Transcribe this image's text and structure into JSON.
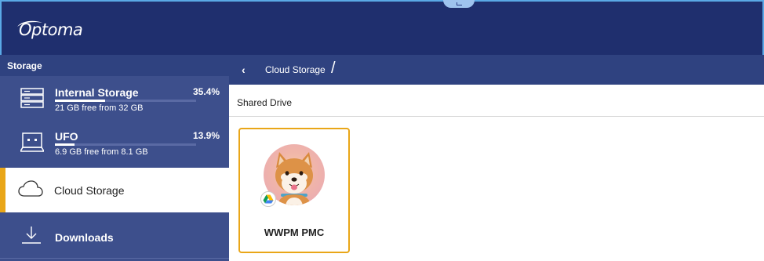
{
  "header": {
    "logo_text": "Optoma"
  },
  "sidebar": {
    "title": "Storage",
    "items": [
      {
        "name": "Internal Storage",
        "percent": "35.4%",
        "detail": "21 GB free from 32 GB",
        "usage_fraction": 0.354,
        "icon": "server-icon"
      },
      {
        "name": "UFO",
        "percent": "13.9%",
        "detail": "6.9 GB free from 8.1 GB",
        "usage_fraction": 0.139,
        "icon": "usb-drive-icon"
      },
      {
        "name": "Cloud Storage",
        "icon": "cloud-icon",
        "selected": true
      },
      {
        "name": "Downloads",
        "icon": "download-icon"
      }
    ]
  },
  "breadcrumb": {
    "back_icon": "‹",
    "current": "Cloud Storage",
    "separator": "/"
  },
  "main": {
    "section_title": "Shared Drive",
    "cards": [
      {
        "label": "WWPM PMC",
        "badge_icon": "google-drive-icon"
      }
    ]
  },
  "colors": {
    "header_bg": "#1f2f6e",
    "sidebar_bg": "#3d4f8c",
    "accent": "#e9a618"
  }
}
